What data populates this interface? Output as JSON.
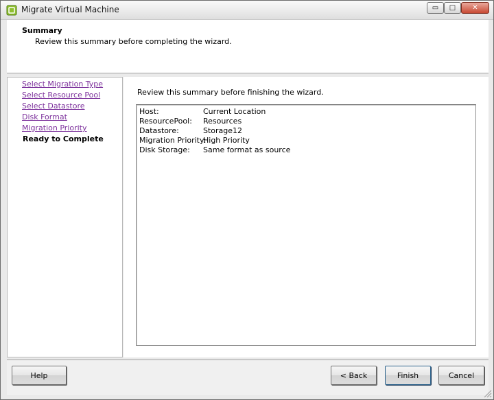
{
  "window": {
    "title": "Migrate Virtual Machine",
    "minimize_glyph": "▭",
    "maximize_glyph": "□",
    "close_glyph": "✕"
  },
  "header": {
    "title": "Summary",
    "subtitle": "Review this summary before completing the wizard."
  },
  "nav": {
    "items": [
      {
        "label": "Select Migration Type",
        "current": false
      },
      {
        "label": "Select Resource Pool",
        "current": false
      },
      {
        "label": "Select Datastore",
        "current": false
      },
      {
        "label": "Disk Format",
        "current": false
      },
      {
        "label": "Migration Priority",
        "current": false
      },
      {
        "label": "Ready to Complete",
        "current": true
      }
    ]
  },
  "main": {
    "intro": "Review this summary before finishing the wizard.",
    "summary": [
      {
        "key": "Host:",
        "value": "Current Location"
      },
      {
        "key": "ResourcePool:",
        "value": "Resources"
      },
      {
        "key": "Datastore:",
        "value": "Storage12"
      },
      {
        "key": "Migration Priority:",
        "value": "High Priority"
      },
      {
        "key": "Disk Storage:",
        "value": "Same format as source"
      }
    ]
  },
  "footer": {
    "help_label": "Help",
    "back_label": "< Back",
    "finish_label": "Finish",
    "cancel_label": "Cancel"
  },
  "colors": {
    "link_visited": "#7b2f9b",
    "close_button": "#c94a33"
  }
}
